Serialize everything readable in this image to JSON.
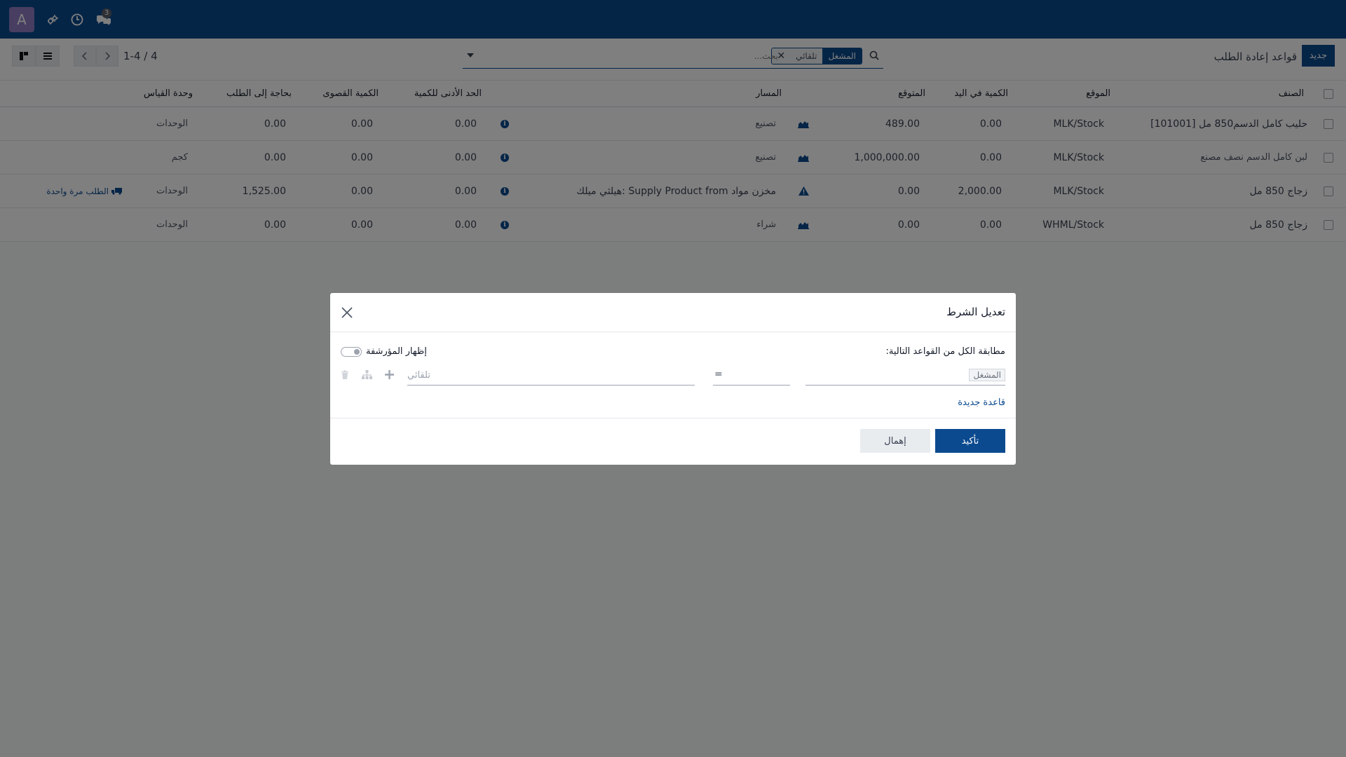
{
  "navbar": {
    "avatar_letter": "A",
    "messages_count": "3"
  },
  "control": {
    "new_button": "جديد",
    "title": "قواعد إعادة الطلب",
    "search_facet_label": "المشغل",
    "search_facet_value": "تلقائي",
    "search_placeholder": "بحث...",
    "pager": "1-4 / 4"
  },
  "list": {
    "headers": {
      "product": "الصنف",
      "location": "الموقع",
      "on_hand": "الكمية في اليد",
      "forecast": "المتوقع",
      "route": "المسار",
      "min_qty": "الحد الأدنى للكمية",
      "max_qty": "الكمية القصوى",
      "to_order": "بحاجة إلى الطلب",
      "uom": "وحدة القياس"
    },
    "rows": [
      {
        "product": "[101001] حليب كامل الدسم850 مل",
        "location": "MLK/Stock",
        "on_hand": "0.00",
        "forecast": "489.00",
        "route": "تصنيع",
        "min_qty": "0.00",
        "max_qty": "0.00",
        "to_order": "0.00",
        "uom": "الوحدات"
      },
      {
        "product": "لبن كامل الدسم نصف مصنع",
        "location": "MLK/Stock",
        "on_hand": "0.00",
        "forecast": "1,000,000.00",
        "route": "تصنيع",
        "min_qty": "0.00",
        "max_qty": "0.00",
        "to_order": "0.00",
        "uom": "كجم"
      },
      {
        "product": "زجاج 850 مل",
        "location": "MLK/Stock",
        "on_hand": "2,000.00",
        "forecast": "0.00",
        "route": "هيلثي ميلك: Supply Product from مخزن مواد",
        "min_qty": "0.00",
        "max_qty": "0.00",
        "to_order": "1,525.00",
        "uom": "الوحدات",
        "order_once": "الطلب مرة واحدة"
      },
      {
        "product": "زجاج 850 مل",
        "location": "WHML/Stock",
        "on_hand": "0.00",
        "forecast": "0.00",
        "route": "شراء",
        "min_qty": "0.00",
        "max_qty": "0.00",
        "to_order": "0.00",
        "uom": "الوحدات"
      }
    ]
  },
  "modal": {
    "title": "تعديل الشرط",
    "match_text": "مطابقة الكل من القواعد التالية:",
    "show_archived": "إظهار المؤرشفة",
    "rule_field": "المشغل",
    "rule_operator": "=",
    "rule_value": "تلقائي",
    "new_rule": "قاعدة جديدة",
    "confirm": "تأكيد",
    "discard": "إهمال"
  }
}
